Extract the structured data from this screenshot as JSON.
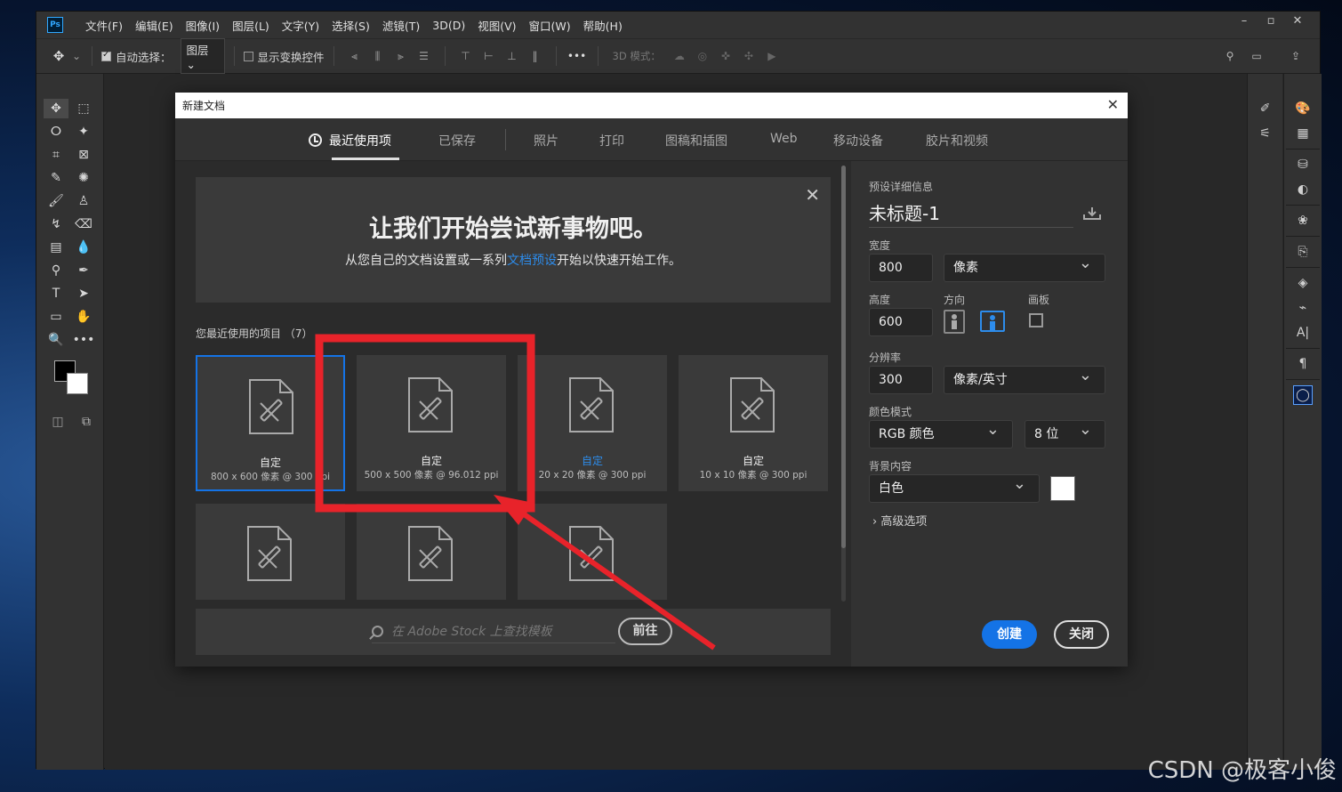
{
  "app": {
    "logo": "Ps",
    "menu": [
      "文件(F)",
      "编辑(E)",
      "图像(I)",
      "图层(L)",
      "文字(Y)",
      "选择(S)",
      "滤镜(T)",
      "3D(D)",
      "视图(V)",
      "窗口(W)",
      "帮助(H)"
    ],
    "window_controls": [
      "minimize-icon",
      "restore-icon",
      "close-icon"
    ]
  },
  "options_bar": {
    "auto_select_label": "自动选择：",
    "auto_select_checked": true,
    "layer_dropdown": "图层",
    "show_transform_label": "显示变换控件",
    "show_transform_checked": false,
    "mode_3d_label": "3D 模式："
  },
  "dialog": {
    "title": "新建文档",
    "tabs": [
      {
        "label": "最近使用项",
        "active": true
      },
      {
        "label": "已保存"
      },
      {
        "label": "照片"
      },
      {
        "label": "打印"
      },
      {
        "label": "图稿和插图"
      },
      {
        "label": "Web"
      },
      {
        "label": "移动设备"
      },
      {
        "label": "胶片和视频"
      }
    ],
    "welcome": {
      "title": "让我们开始尝试新事物吧。",
      "subtitle_before": "从您自己的文档设置或一系列",
      "subtitle_link": "文档预设",
      "subtitle_after": "开始以快速开始工作。"
    },
    "recent": {
      "header": "您最近使用的项目 （7）",
      "items": [
        {
          "title": "自定",
          "subtitle": "800 x 600 像素 @ 300 ppi",
          "selected": true
        },
        {
          "title": "自定",
          "subtitle": "500 x 500 像素 @ 96.012 ppi"
        },
        {
          "title": "自定",
          "subtitle": "20 x 20 像素 @ 300 ppi",
          "highlight": true
        },
        {
          "title": "自定",
          "subtitle": "10 x 10 像素 @ 300 ppi"
        },
        {
          "title": "",
          "subtitle": ""
        },
        {
          "title": "",
          "subtitle": ""
        },
        {
          "title": "",
          "subtitle": ""
        }
      ]
    },
    "stock": {
      "placeholder": "在 Adobe Stock 上查找模板",
      "go_label": "前往"
    },
    "preset": {
      "header": "预设详细信息",
      "doc_name": "未标题-1",
      "width_label": "宽度",
      "width_value": "800",
      "width_unit": "像素",
      "height_label": "高度",
      "height_value": "600",
      "orientation_label": "方向",
      "orientation": "landscape",
      "artboard_label": "画板",
      "artboard_checked": false,
      "resolution_label": "分辨率",
      "resolution_value": "300",
      "resolution_unit": "像素/英寸",
      "color_mode_label": "颜色模式",
      "color_mode": "RGB 颜色",
      "bit_depth": "8 位",
      "background_label": "背景内容",
      "background": "白色",
      "background_color": "#ffffff",
      "advanced_label": "高级选项",
      "create_label": "创建",
      "close_label": "关闭"
    }
  },
  "colors": {
    "accent": "#1473e6",
    "link": "#2d8ceb",
    "annotation": "#e8232a",
    "foreground_color": "#000000",
    "background_color": "#ffffff"
  },
  "watermark": "CSDN @极客小俊"
}
